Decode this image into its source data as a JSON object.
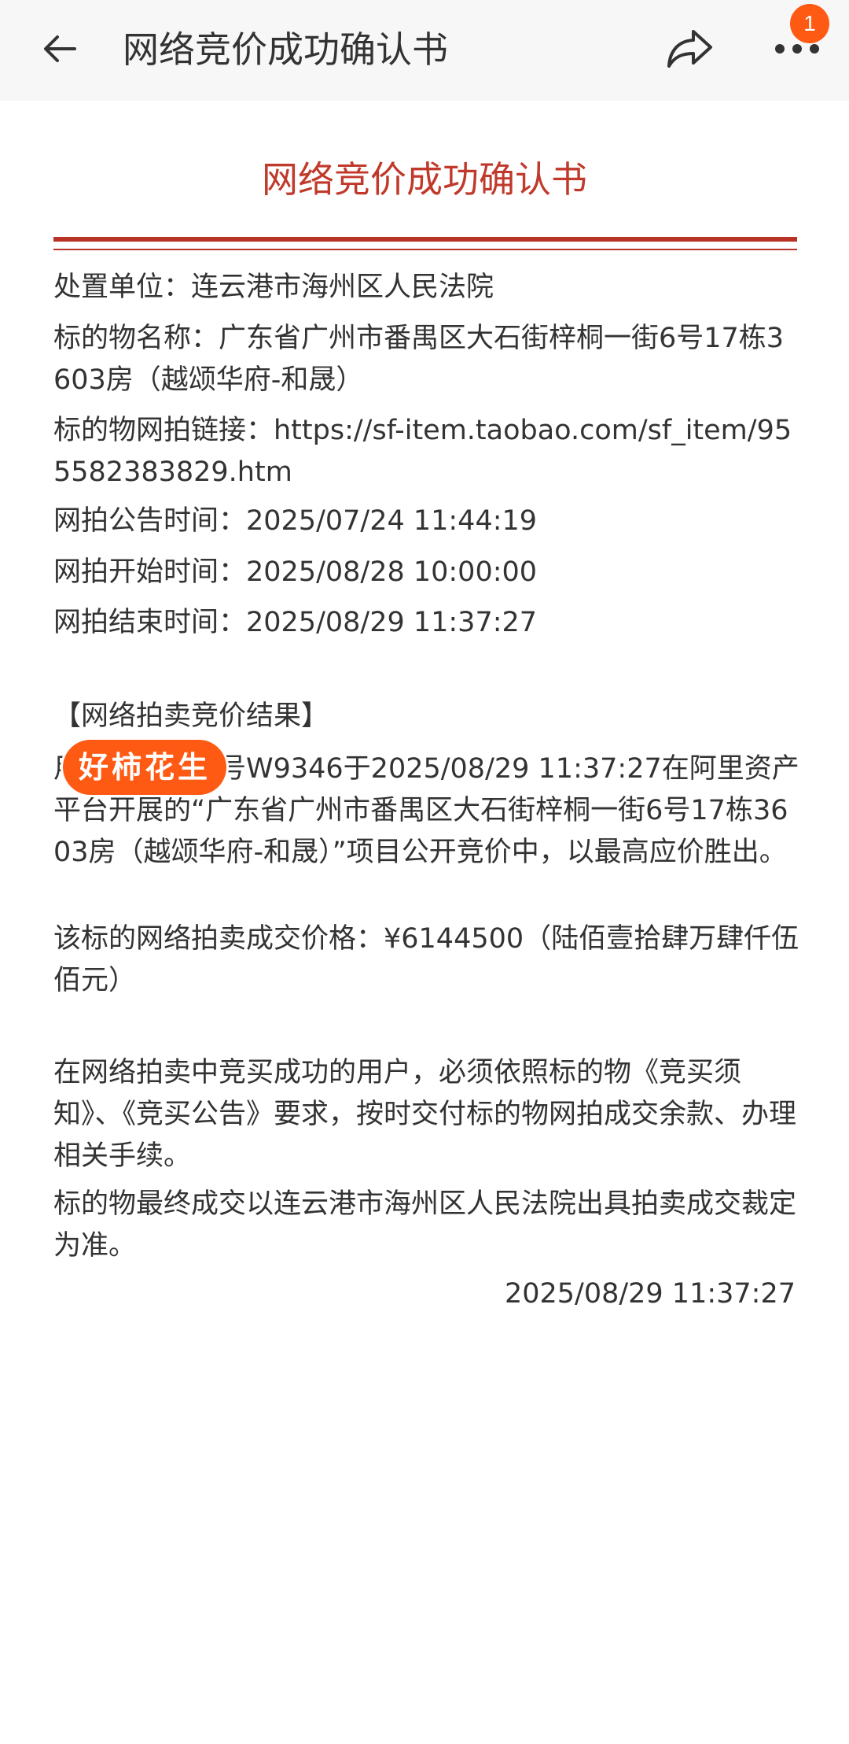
{
  "nav": {
    "title": "网络竞价成功确认书",
    "badge_count": "1"
  },
  "document": {
    "title": "网络竞价成功确认书",
    "disposal_unit": "处置单位：连云港市海州区人民法院",
    "object_name": "标的物名称：广东省广州市番禺区大石街梓桐一街6号17栋3603房（越颂华府-和晟）",
    "object_link": "标的物网拍链接：https://sf-item.taobao.com/sf_item/955582383829.htm",
    "announce_time": "网拍公告时间：2025/07/24 11:44:19",
    "start_time": "网拍开始时间：2025/08/28 10:00:00",
    "end_time": "网拍结束时间：2025/08/29 11:37:27",
    "result_heading": "【网络拍卖竞价结果】",
    "result_body": "用户通过竞买号W9346于2025/08/29 11:37:27在阿里资产平台开展的“广东省广州市番禺区大石街梓桐一街6号17栋3603房（越颂华府-和晟）”项目公开竞价中，以最高应价胜出。",
    "deal_price": "该标的网络拍卖成交价格：¥6144500（陆佰壹拾肆万肆仟伍佰元）",
    "notice_1": "在网络拍卖中竞买成功的用户，必须依照标的物《竞买须知》、《竞买公告》要求，按时交付标的物网拍成交余款、办理相关手续。",
    "notice_2": "标的物最终成交以连云港市海州区人民法院出具拍卖成交裁定为准。",
    "signed_time": "2025/08/29 11:37:27"
  },
  "watermark": {
    "text": "好柿花生"
  },
  "colors": {
    "accent_red": "#c0392b",
    "badge_orange": "#ff5a14",
    "topbar_bg": "#f7f7f7"
  },
  "icons": {
    "back": "back-arrow-icon",
    "share": "share-icon",
    "more": "more-dots-icon"
  }
}
